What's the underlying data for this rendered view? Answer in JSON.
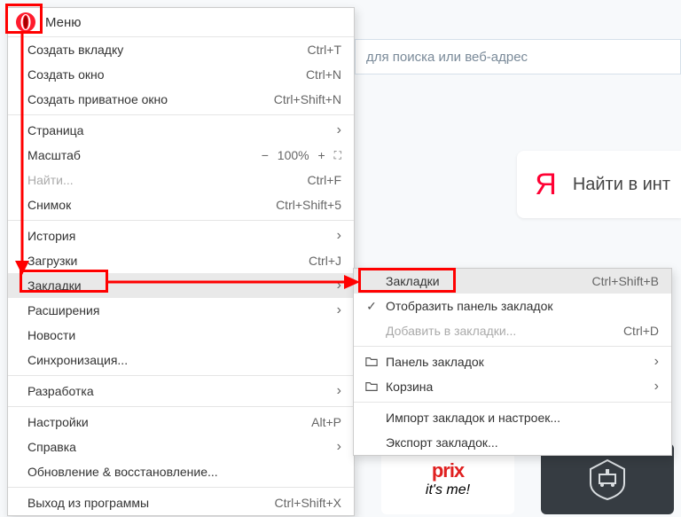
{
  "address_bar": {
    "placeholder": "для поиска или веб-адрес"
  },
  "yandex": {
    "letter": "Я",
    "text": "Найти в инт"
  },
  "thumb_prix": {
    "line1": "prix",
    "line2": "it's me!"
  },
  "menu": {
    "title": "Меню",
    "items": [
      {
        "label": "Создать вкладку",
        "shortcut": "Ctrl+T"
      },
      {
        "label": "Создать окно",
        "shortcut": "Ctrl+N"
      },
      {
        "label": "Создать приватное окно",
        "shortcut": "Ctrl+Shift+N"
      }
    ],
    "page": {
      "label": "Страница"
    },
    "zoom": {
      "label": "Масштаб",
      "minus": "−",
      "value": "100%",
      "plus": "+"
    },
    "find": {
      "label": "Найти...",
      "shortcut": "Ctrl+F"
    },
    "snapshot": {
      "label": "Снимок",
      "shortcut": "Ctrl+Shift+5"
    },
    "history": {
      "label": "История"
    },
    "downloads": {
      "label": "Загрузки",
      "shortcut": "Ctrl+J"
    },
    "bookmarks": {
      "label": "Закладки"
    },
    "extensions": {
      "label": "Расширения"
    },
    "news": {
      "label": "Новости"
    },
    "sync": {
      "label": "Синхронизация..."
    },
    "dev": {
      "label": "Разработка"
    },
    "settings": {
      "label": "Настройки",
      "shortcut": "Alt+P"
    },
    "help": {
      "label": "Справка"
    },
    "update": {
      "label": "Обновление & восстановление..."
    },
    "exit": {
      "label": "Выход из программы",
      "shortcut": "Ctrl+Shift+X"
    }
  },
  "submenu": {
    "bookmarks": {
      "label": "Закладки",
      "shortcut": "Ctrl+Shift+B"
    },
    "show_bar": {
      "label": "Отобразить панель закладок"
    },
    "add": {
      "label": "Добавить в закладки...",
      "shortcut": "Ctrl+D"
    },
    "panel": {
      "label": "Панель закладок"
    },
    "trash": {
      "label": "Корзина"
    },
    "import": {
      "label": "Импорт закладок и настроек..."
    },
    "export": {
      "label": "Экспорт закладок..."
    }
  }
}
